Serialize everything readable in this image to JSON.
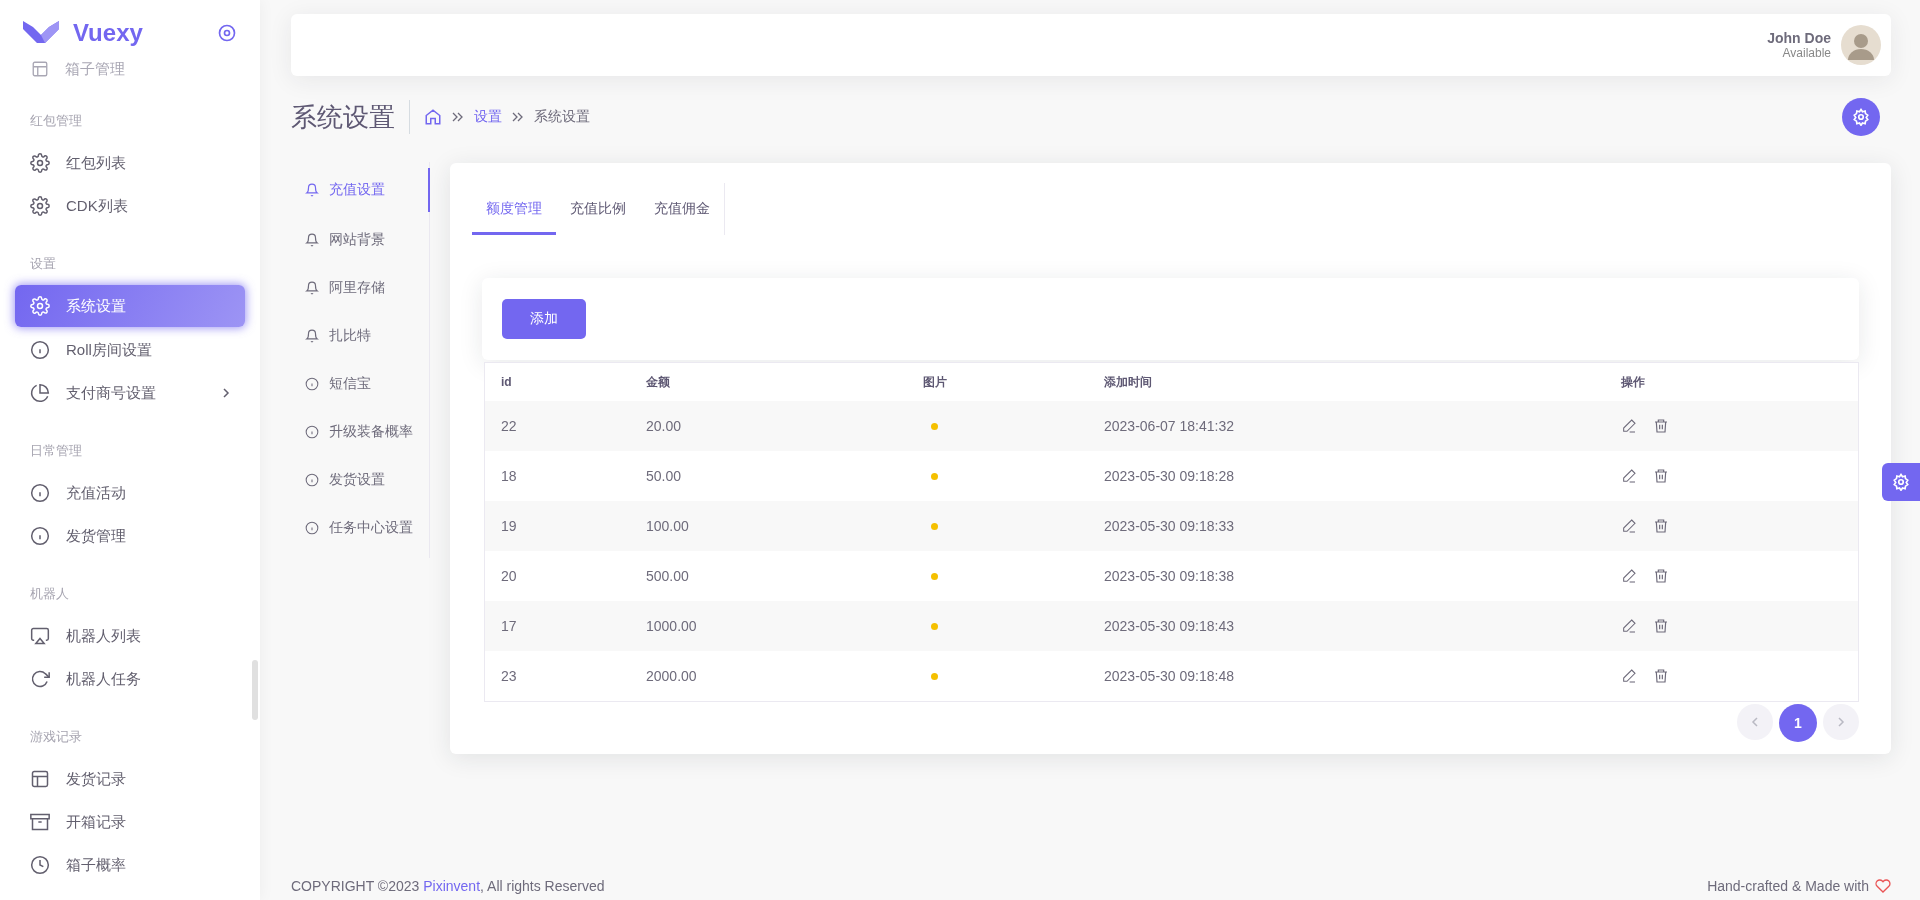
{
  "sidebar": {
    "brand": "Vuexy",
    "faded_item": {
      "label": "箱子管理",
      "kind": "layout"
    },
    "sections": [
      {
        "title": "红包管理",
        "items": [
          {
            "label": "红包列表",
            "kind": "gear",
            "selected": false,
            "expandable": false
          },
          {
            "label": "CDK列表",
            "kind": "gear",
            "selected": false,
            "expandable": false
          }
        ]
      },
      {
        "title": "设置",
        "items": [
          {
            "label": "系统设置",
            "kind": "gear",
            "selected": true,
            "expandable": false
          },
          {
            "label": "Roll房间设置",
            "kind": "info",
            "selected": false,
            "expandable": false
          },
          {
            "label": "支付商号设置",
            "kind": "pie",
            "selected": false,
            "expandable": true
          }
        ]
      },
      {
        "title": "日常管理",
        "items": [
          {
            "label": "充值活动",
            "kind": "info",
            "selected": false,
            "expandable": false
          },
          {
            "label": "发货管理",
            "kind": "info",
            "selected": false,
            "expandable": false
          }
        ]
      },
      {
        "title": "机器人",
        "items": [
          {
            "label": "机器人列表",
            "kind": "monitor",
            "selected": false,
            "expandable": false
          },
          {
            "label": "机器人任务",
            "kind": "refresh",
            "selected": false,
            "expandable": false
          }
        ]
      },
      {
        "title": "游戏记录",
        "items": [
          {
            "label": "发货记录",
            "kind": "layout",
            "selected": false,
            "expandable": false
          },
          {
            "label": "开箱记录",
            "kind": "archive",
            "selected": false,
            "expandable": false
          },
          {
            "label": "箱子概率",
            "kind": "clock",
            "selected": false,
            "expandable": false
          }
        ]
      }
    ]
  },
  "user": {
    "name": "John Doe",
    "status": "Available"
  },
  "page": {
    "title": "系统设置",
    "breadcrumb": [
      {
        "label": "设置",
        "kind": "link"
      },
      {
        "label": "系统设置",
        "kind": "current"
      }
    ]
  },
  "settings_nav": [
    {
      "label": "充值设置",
      "kind": "bell",
      "selected": true
    },
    {
      "label": "网站背景",
      "kind": "bell",
      "selected": false
    },
    {
      "label": "阿里存储",
      "kind": "bell",
      "selected": false
    },
    {
      "label": "扎比特",
      "kind": "bell",
      "selected": false
    },
    {
      "label": "短信宝",
      "kind": "info",
      "selected": false
    },
    {
      "label": "升级装备概率",
      "kind": "info",
      "selected": false
    },
    {
      "label": "发货设置",
      "kind": "info",
      "selected": false
    },
    {
      "label": "任务中心设置",
      "kind": "info",
      "selected": false
    }
  ],
  "tabs": [
    {
      "label": "额度管理",
      "selected": true
    },
    {
      "label": "充值比例",
      "selected": false
    },
    {
      "label": "充值佣金",
      "selected": false
    }
  ],
  "add_button": "添加",
  "table": {
    "columns": [
      "id",
      "金额",
      "图片",
      "添加时间",
      "操作"
    ],
    "rows": [
      {
        "id": "22",
        "amount": "20.00",
        "time": "2023-06-07 18:41:32"
      },
      {
        "id": "18",
        "amount": "50.00",
        "time": "2023-05-30 09:18:28"
      },
      {
        "id": "19",
        "amount": "100.00",
        "time": "2023-05-30 09:18:33"
      },
      {
        "id": "20",
        "amount": "500.00",
        "time": "2023-05-30 09:18:38"
      },
      {
        "id": "17",
        "amount": "1000.00",
        "time": "2023-05-30 09:18:43"
      },
      {
        "id": "23",
        "amount": "2000.00",
        "time": "2023-05-30 09:18:48"
      }
    ]
  },
  "pagination": {
    "pages": [
      {
        "label": "1",
        "selected": true
      }
    ]
  },
  "footer": {
    "copyright": "COPYRIGHT ©2023",
    "company": "Pixinvent",
    "rights": ", All rights Reserved",
    "credit": "Hand-crafted & Made with"
  }
}
